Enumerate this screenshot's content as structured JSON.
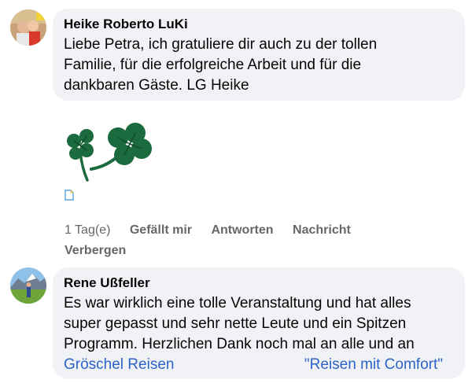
{
  "comments": [
    {
      "author": "Heike Roberto LuKi",
      "text": "Liebe Petra, ich gratuliere dir auch zu der tollen Familie,  für die erfolgreiche Arbeit und für die dankbaren Gäste. LG Heike",
      "lines": [
        "Liebe Petra, ich gratuliere dir auch zu der tollen",
        "Familie,  für die erfolgreiche Arbeit und für die",
        "dankbaren Gäste. LG Heike"
      ],
      "attachment": "four-leaf-clover-sticker",
      "actions": {
        "time": "1 Tag(e)",
        "like": "Gefällt mir",
        "reply": "Antworten",
        "message": "Nachricht",
        "hide": "Verbergen"
      }
    },
    {
      "author": "Rene Ußfeller",
      "lines": [
        "Es war wirklich eine tolle Veranstaltung und hat alles",
        "super gepasst und sehr nette Leute und ein Spitzen",
        "Programm. Herzlichen Dank noch mal an alle und an"
      ],
      "link_left": "Gröschel Reisen",
      "link_right": "\"Reisen mit Comfort\""
    }
  ],
  "colors": {
    "bubble": "#f0f2f5",
    "meta": "#65676b",
    "link": "#2d63c8",
    "clover": "#1b6b3e"
  }
}
